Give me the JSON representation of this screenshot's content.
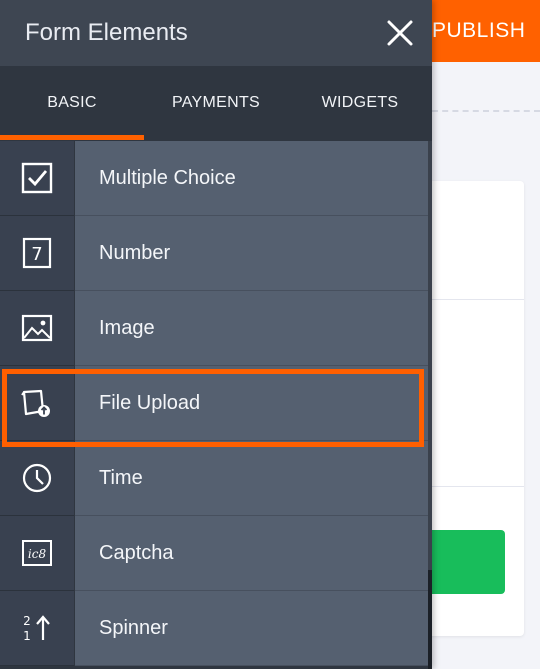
{
  "background": {
    "publish_label": "PUBLISH"
  },
  "panel": {
    "title": "Form Elements",
    "close_icon": "close-icon"
  },
  "tabs": [
    {
      "label": "BASIC",
      "active": true
    },
    {
      "label": "PAYMENTS",
      "active": false
    },
    {
      "label": "WIDGETS",
      "active": false
    }
  ],
  "items": [
    {
      "label": "Multiple Choice",
      "icon": "checkbox-icon"
    },
    {
      "label": "Number",
      "icon": "number-icon",
      "icon_text": "7"
    },
    {
      "label": "Image",
      "icon": "image-icon"
    },
    {
      "label": "File Upload",
      "icon": "file-upload-icon",
      "highlighted": true
    },
    {
      "label": "Time",
      "icon": "clock-icon"
    },
    {
      "label": "Captcha",
      "icon": "captcha-icon",
      "icon_text": "ic8"
    },
    {
      "label": "Spinner",
      "icon": "spinner-icon",
      "icon_text_top": "2",
      "icon_text_bottom": "1"
    }
  ],
  "colors": {
    "accent": "#ff6100",
    "panel_bg": "#2f3640",
    "item_bg": "#556070",
    "icon_bg": "#394150",
    "submit_green": "#18bd5b"
  }
}
